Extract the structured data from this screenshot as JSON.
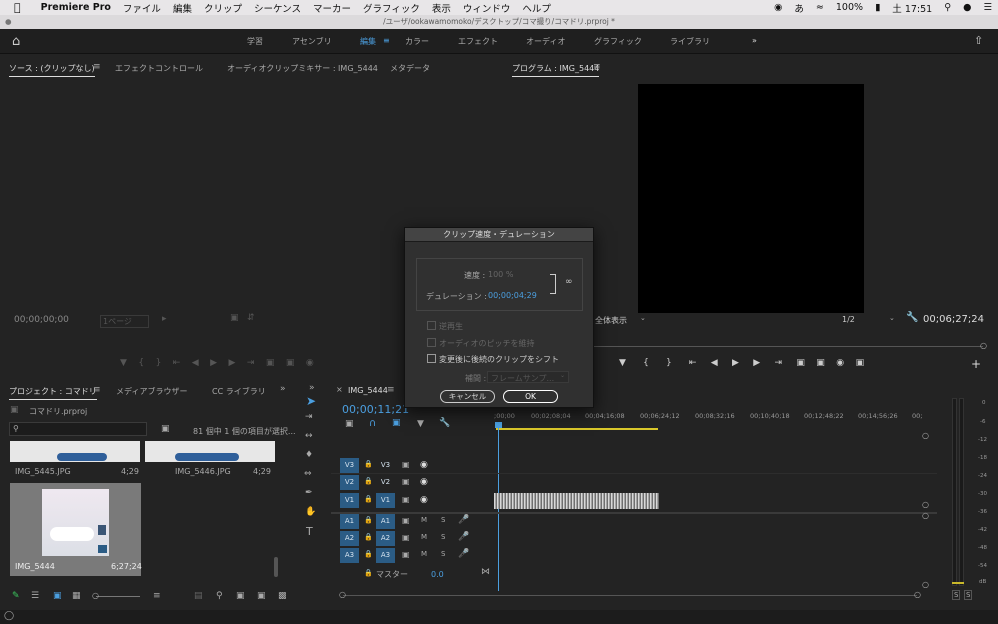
{
  "menubar": {
    "apple": "",
    "app": "Premiere Pro",
    "items": [
      "ファイル",
      "編集",
      "クリップ",
      "シーケンス",
      "マーカー",
      "グラフィック",
      "表示",
      "ウィンドウ",
      "ヘルプ"
    ],
    "battery": "100%",
    "clock": "土 17:51"
  },
  "window": {
    "path": "/ユーザ/ookawamomoko/デスクトップ/コマ撮り/コマドリ.prproj *"
  },
  "workspaces": {
    "tabs": [
      "学習",
      "アセンブリ",
      "編集",
      "カラー",
      "エフェクト",
      "オーディオ",
      "グラフィック",
      "ライブラリ"
    ],
    "active": "編集",
    "more": "»"
  },
  "source": {
    "tabs": [
      "ソース : (クリップなし)",
      "エフェクトコントロール",
      "オーディオクリップミキサー : IMG_5444",
      "メタデータ"
    ],
    "timecode": "00;00;00;00",
    "page": "1ページ"
  },
  "program": {
    "title": "プログラム : IMG_5444",
    "fit": "全体表示",
    "resolution": "1/2",
    "timecode": "00;06;27;24"
  },
  "project": {
    "tabs": [
      "プロジェクト : コマドリ",
      "メディアブラウザー",
      "CC ライブラリ"
    ],
    "file": "コマドリ.prproj",
    "count": "81 個中 1 個の項目が選択...",
    "items": [
      {
        "name": "IMG_5445.JPG",
        "duration": "4;29"
      },
      {
        "name": "IMG_5446.JPG",
        "duration": "4;29"
      },
      {
        "name": "IMG_5444",
        "duration": "6;27;24"
      }
    ]
  },
  "timeline": {
    "sequence": "IMG_5444",
    "timecode": "00;00;11;21",
    "ruler": [
      ";00;00",
      "00;02;08;04",
      "00;04;16;08",
      "00;06;24;12",
      "00;08;32;16",
      "00;10;40;18",
      "00;12;48;22",
      "00;14;56;26",
      "00;"
    ],
    "video_tracks": [
      {
        "src": "V3",
        "trk": "V3"
      },
      {
        "src": "V2",
        "trk": "V2"
      },
      {
        "src": "V1",
        "trk": "V1"
      }
    ],
    "audio_tracks": [
      {
        "src": "A1",
        "trk": "A1"
      },
      {
        "src": "A2",
        "trk": "A2"
      },
      {
        "src": "A3",
        "trk": "A3"
      }
    ],
    "mute": "M",
    "solo": "S",
    "master": "マスター",
    "master_val": "0.0"
  },
  "meter": {
    "marks": [
      "0",
      "-6",
      "-12",
      "-18",
      "-24",
      "-30",
      "-36",
      "-42",
      "-48",
      "-54",
      "dB"
    ],
    "solo": [
      "S",
      "S"
    ]
  },
  "dialog": {
    "title": "クリップ速度・デュレーション",
    "speed_label": "速度 :",
    "speed_value": "100 %",
    "duration_label": "デュレーション :",
    "duration_value": "00;00;04;29",
    "reverse": "逆再生",
    "pitch": "オーディオのピッチを維持",
    "ripple": "変更後に後続のクリップをシフト",
    "interp_label": "補間 :",
    "interp_value": "フレームサンプ...",
    "cancel": "キャンセル",
    "ok": "OK"
  }
}
